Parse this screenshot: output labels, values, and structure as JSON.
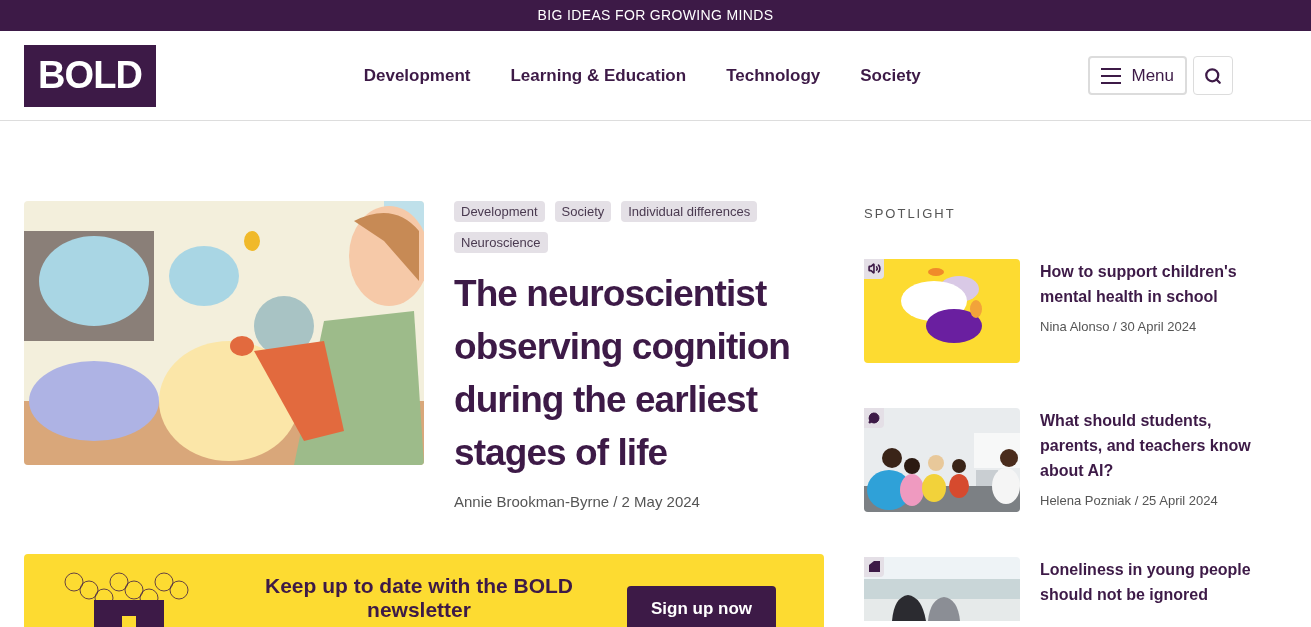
{
  "top_banner": {
    "text": "BIG IDEAS FOR GROWING MINDS"
  },
  "header": {
    "logo": "BOLD",
    "nav": [
      "Development",
      "Learning & Education",
      "Technology",
      "Society"
    ],
    "menu_button": "Menu"
  },
  "featured": {
    "tags": [
      "Development",
      "Society",
      "Individual differences",
      "Neuroscience"
    ],
    "title": "The neuroscientist observing cognition during the earliest stages of life",
    "byline": "Annie Brookman-Byrne / 2 May 2024"
  },
  "spotlight": {
    "heading": "SPOTLIGHT",
    "items": [
      {
        "kind": "audio",
        "title": "How to support children's mental health in school",
        "byline": "Nina Alonso / 30 April 2024"
      },
      {
        "kind": "discussion",
        "title": "What should students, parents, and teachers know about AI?",
        "byline": "Helena Pozniak / 25 April 2024"
      },
      {
        "kind": "article",
        "title": "Loneliness in young people should not be ignored"
      }
    ]
  },
  "newsletter": {
    "text": "Keep up to date with the BOLD newsletter",
    "button": "Sign up now"
  }
}
